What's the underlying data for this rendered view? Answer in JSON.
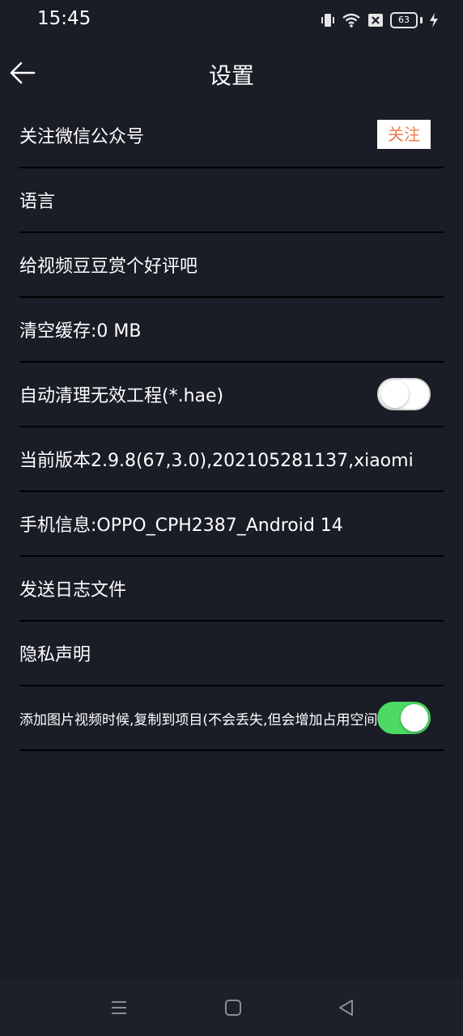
{
  "status_bar": {
    "time": "15:45",
    "battery": "63",
    "icons": [
      "vibrate-icon",
      "wifi-icon",
      "no-sim-icon",
      "battery-icon",
      "charging-icon"
    ]
  },
  "header": {
    "title": "设置",
    "back_icon": "back-arrow-icon"
  },
  "settings": {
    "follow_wechat": {
      "label": "关注微信公众号",
      "button": "关注"
    },
    "language": {
      "label": "语言"
    },
    "rate": {
      "label": "给视频豆豆赏个好评吧"
    },
    "clear_cache": {
      "label": "清空缓存:0 MB"
    },
    "auto_clean": {
      "label": "自动清理无效工程(*.hae)",
      "enabled": false
    },
    "version": {
      "label": "当前版本2.9.8(67,3.0),202105281137,xiaomi"
    },
    "phone_info": {
      "label": "手机信息:OPPO_CPH2387_Android 14"
    },
    "send_log": {
      "label": "发送日志文件"
    },
    "privacy": {
      "label": "隐私声明"
    },
    "copy_media": {
      "label": "添加图片视频时候,复制到项目(不会丢失,但会增加占用空间)",
      "enabled": true
    }
  },
  "colors": {
    "background": "#1a1c26",
    "accent": "#ef7a4b",
    "toggle_on": "#4cd964"
  },
  "nav_bar": {
    "icons": [
      "menu-icon",
      "home-icon",
      "back-icon"
    ]
  }
}
